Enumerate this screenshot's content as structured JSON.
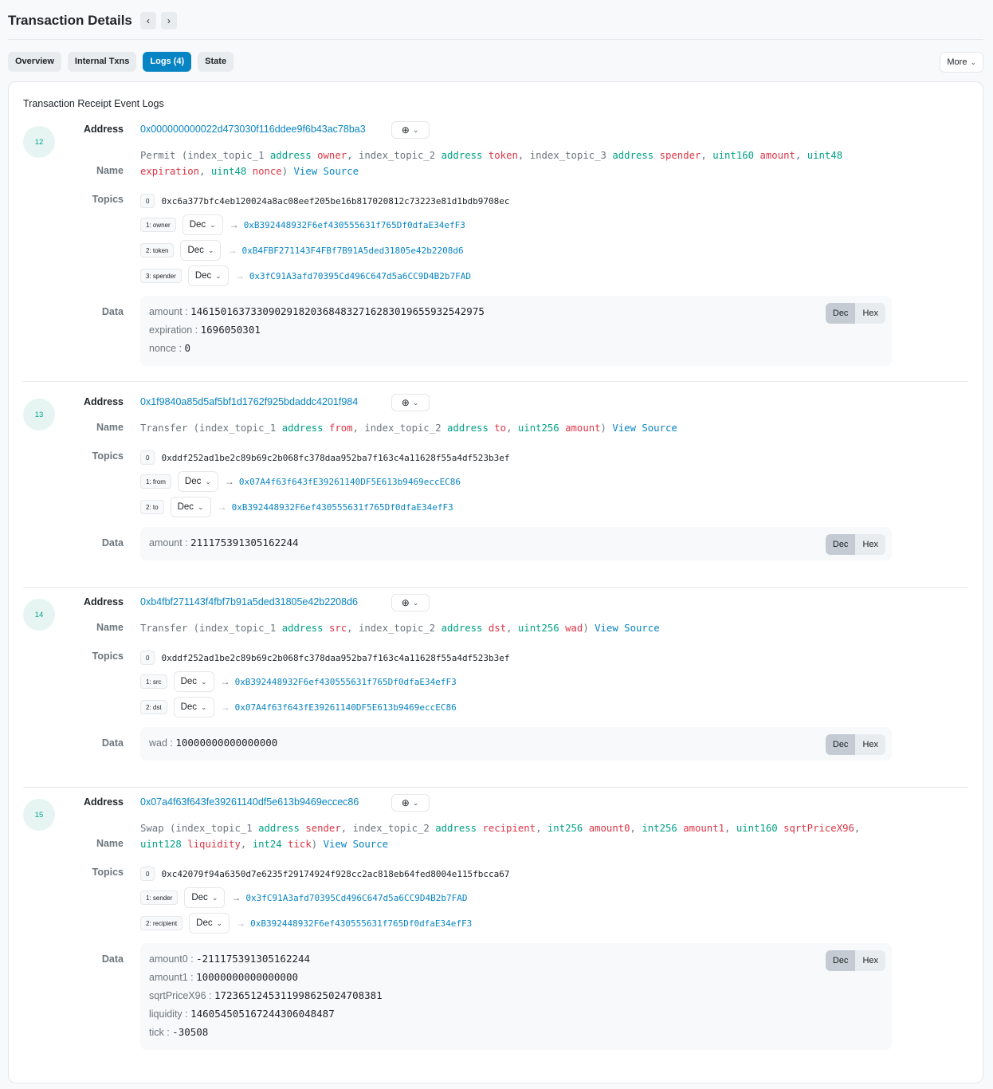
{
  "header": {
    "title": "Transaction Details",
    "prev_icon": "chevron-left",
    "next_icon": "chevron-right"
  },
  "tabs": [
    {
      "label": "Overview",
      "active": false
    },
    {
      "label": "Internal Txns",
      "active": false
    },
    {
      "label": "Logs (4)",
      "active": true
    },
    {
      "label": "State",
      "active": false
    }
  ],
  "more_label": "More",
  "card_title": "Transaction Receipt Event Logs",
  "labels": {
    "address": "Address",
    "name": "Name",
    "topics": "Topics",
    "data": "Data",
    "view_source": "View Source",
    "dec": "Dec",
    "hex": "Hex"
  },
  "colors": {
    "accent": "#0784c3",
    "type": "#00a186",
    "param": "#dc3545"
  },
  "logs": [
    {
      "index": "12",
      "address": "0x000000000022d473030f116ddee9f6b43ac78ba3",
      "event": "Permit",
      "params": [
        {
          "topic": "index_topic_1",
          "type": "address",
          "name": "owner"
        },
        {
          "topic": "index_topic_2",
          "type": "address",
          "name": "token"
        },
        {
          "topic": "index_topic_3",
          "type": "address",
          "name": "spender"
        },
        {
          "type": "uint160",
          "name": "amount"
        },
        {
          "type": "uint48",
          "name": "expiration"
        },
        {
          "type": "uint48",
          "name": "nonce"
        }
      ],
      "topic0": "0xc6a377bfc4eb120024a8ac08eef205be16b817020812c73223e81d1bdb9708ec",
      "topics": [
        {
          "label": "1: owner",
          "format": "Dec",
          "value": "0xB392448932F6ef430555631f765Df0dfaE34efF3"
        },
        {
          "label": "2: token",
          "format": "Dec",
          "value": "0xB4FBF271143F4FBf7B91A5ded31805e42b2208d6"
        },
        {
          "label": "3: spender",
          "format": "Dec",
          "value": "0x3fC91A3afd70395Cd496C647d5a6CC9D4B2b7FAD"
        }
      ],
      "data": [
        {
          "key": "amount",
          "value": "1461501637330902918203684832716283019655932542975"
        },
        {
          "key": "expiration",
          "value": "1696050301"
        },
        {
          "key": "nonce",
          "value": "0"
        }
      ]
    },
    {
      "index": "13",
      "address": "0x1f9840a85d5af5bf1d1762f925bdaddc4201f984",
      "event": "Transfer",
      "params": [
        {
          "topic": "index_topic_1",
          "type": "address",
          "name": "from"
        },
        {
          "topic": "index_topic_2",
          "type": "address",
          "name": "to"
        },
        {
          "type": "uint256",
          "name": "amount"
        }
      ],
      "topic0": "0xddf252ad1be2c89b69c2b068fc378daa952ba7f163c4a11628f55a4df523b3ef",
      "topics": [
        {
          "label": "1: from",
          "format": "Dec",
          "value": "0x07A4f63f643fE39261140DF5E613b9469eccEC86"
        },
        {
          "label": "2: to",
          "format": "Dec",
          "value": "0xB392448932F6ef430555631f765Df0dfaE34efF3"
        }
      ],
      "data": [
        {
          "key": "amount",
          "value": "211175391305162244"
        }
      ]
    },
    {
      "index": "14",
      "address": "0xb4fbf271143f4fbf7b91a5ded31805e42b2208d6",
      "event": "Transfer",
      "params": [
        {
          "topic": "index_topic_1",
          "type": "address",
          "name": "src"
        },
        {
          "topic": "index_topic_2",
          "type": "address",
          "name": "dst"
        },
        {
          "type": "uint256",
          "name": "wad"
        }
      ],
      "topic0": "0xddf252ad1be2c89b69c2b068fc378daa952ba7f163c4a11628f55a4df523b3ef",
      "topics": [
        {
          "label": "1: src",
          "format": "Dec",
          "value": "0xB392448932F6ef430555631f765Df0dfaE34efF3"
        },
        {
          "label": "2: dst",
          "format": "Dec",
          "value": "0x07A4f63f643fE39261140DF5E613b9469eccEC86"
        }
      ],
      "data": [
        {
          "key": "wad",
          "value": "10000000000000000"
        }
      ]
    },
    {
      "index": "15",
      "address": "0x07a4f63f643fe39261140df5e613b9469eccec86",
      "event": "Swap",
      "params": [
        {
          "topic": "index_topic_1",
          "type": "address",
          "name": "sender"
        },
        {
          "topic": "index_topic_2",
          "type": "address",
          "name": "recipient"
        },
        {
          "type": "int256",
          "name": "amount0"
        },
        {
          "type": "int256",
          "name": "amount1"
        },
        {
          "type": "uint160",
          "name": "sqrtPriceX96"
        },
        {
          "type": "uint128",
          "name": "liquidity"
        },
        {
          "type": "int24",
          "name": "tick"
        }
      ],
      "topic0": "0xc42079f94a6350d7e6235f29174924f928cc2ac818eb64fed8004e115fbcca67",
      "topics": [
        {
          "label": "1: sender",
          "format": "Dec",
          "value": "0x3fC91A3afd70395Cd496C647d5a6CC9D4B2b7FAD"
        },
        {
          "label": "2: recipient",
          "format": "Dec",
          "value": "0xB392448932F6ef430555631f765Df0dfaE34efF3"
        }
      ],
      "data": [
        {
          "key": "amount0",
          "value": "-211175391305162244"
        },
        {
          "key": "amount1",
          "value": "10000000000000000"
        },
        {
          "key": "sqrtPriceX96",
          "value": "1723651245311998625024708381"
        },
        {
          "key": "liquidity",
          "value": "146054505167244306048487"
        },
        {
          "key": "tick",
          "value": "-30508"
        }
      ]
    }
  ]
}
